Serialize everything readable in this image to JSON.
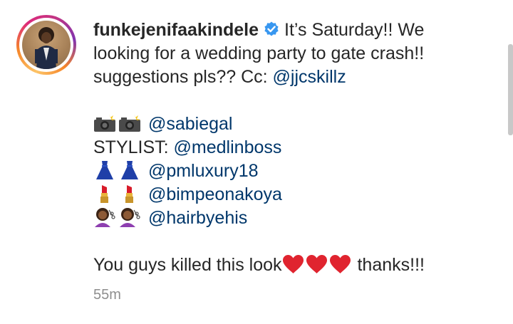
{
  "post": {
    "username": "funkejenifaakindele",
    "verified": true,
    "caption_line1": "It’s Saturday!! We",
    "caption_line2": "looking for a wedding party to gate crash!!",
    "caption_line3_prefix": "suggestions pls?? Cc:",
    "cc_mention": "@jjcskillz",
    "credits": [
      {
        "emoji": "camera-with-flash-icon",
        "prefix": "",
        "mention": "@sabiegal"
      },
      {
        "emoji": "",
        "prefix": "STYLIST:",
        "mention": "@medlinboss"
      },
      {
        "emoji": "dress-icon",
        "prefix": "",
        "mention": "@pmluxury18"
      },
      {
        "emoji": "lipstick-icon",
        "prefix": "",
        "mention": "@bimpeonakoya"
      },
      {
        "emoji": "haircut-icon",
        "prefix": "",
        "mention": "@hairbyehis"
      }
    ],
    "closing_text": "You guys killed this look",
    "closing_emoji": "red-heart-icon",
    "closing_suffix": "thanks!!!",
    "timestamp": "55m"
  },
  "colors": {
    "text": "#262626",
    "mention": "#00376b",
    "verified_badge": "#3897f0",
    "timestamp": "#8e8e8e",
    "heart": "#e0242f"
  }
}
